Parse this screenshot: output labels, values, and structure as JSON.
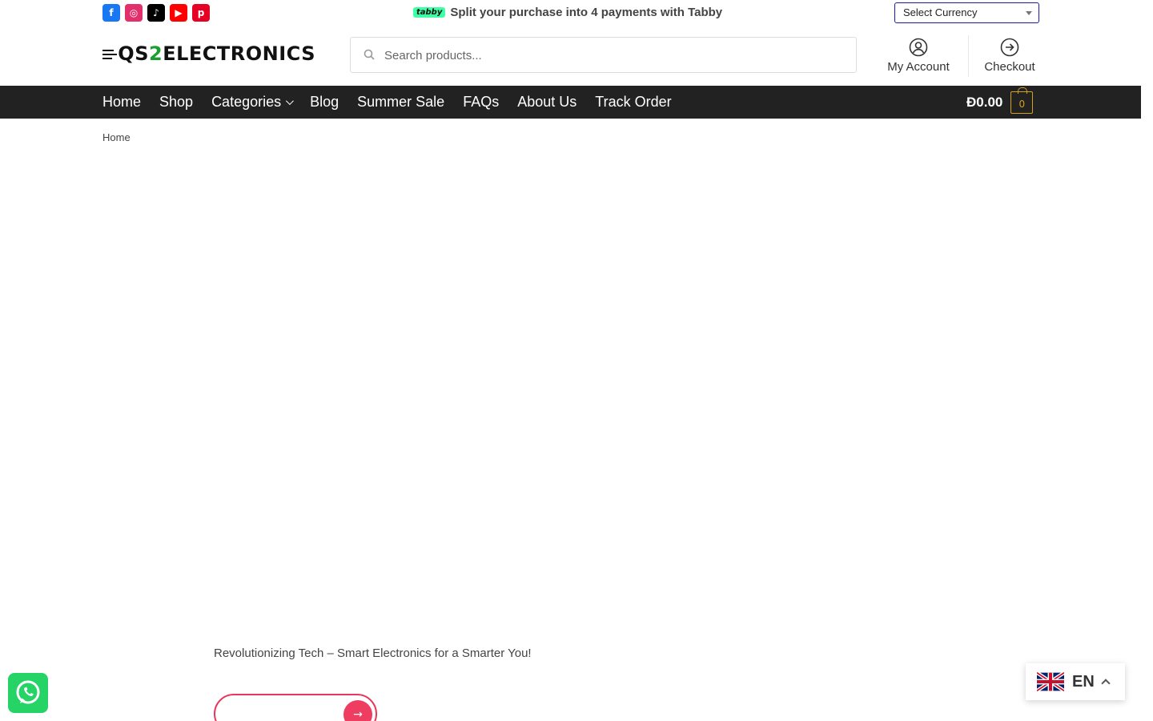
{
  "topbar": {
    "social": [
      {
        "name": "facebook-icon",
        "glyph": "f",
        "color": "#1877f2"
      },
      {
        "name": "instagram-icon",
        "glyph": "◎",
        "color": "#e1306c"
      },
      {
        "name": "tiktok-icon",
        "glyph": "♪",
        "color": "#000000"
      },
      {
        "name": "youtube-icon",
        "glyph": "▶",
        "color": "#ff0000"
      },
      {
        "name": "pinterest-icon",
        "glyph": "p",
        "color": "#e60023"
      }
    ],
    "tabby_badge": "tabby",
    "tabby_text": "Split your purchase into 4 payments with Tabby",
    "currency_label": "Select Currency"
  },
  "header": {
    "logo_prefix": "QS",
    "logo_highlight": "2",
    "logo_suffix": "ELECTRONICS",
    "search_placeholder": "Search products...",
    "account_label": "My Account",
    "checkout_label": "Checkout"
  },
  "nav": {
    "items": [
      "Home",
      "Shop",
      "Categories",
      "Blog",
      "Summer Sale",
      "FAQs",
      "About Us",
      "Track Order"
    ],
    "cart_total": "Ð0.00",
    "cart_count": "0"
  },
  "breadcrumb": "Home",
  "footer": {
    "tagline": "Revolutionizing Tech – Smart Electronics for a Smarter You!"
  },
  "language": {
    "code": "EN"
  },
  "colors": {
    "nav_bg": "#222222",
    "accent": "#ef3d61",
    "cart_accent": "#d4a017",
    "brand_green": "#1b9e2f"
  }
}
